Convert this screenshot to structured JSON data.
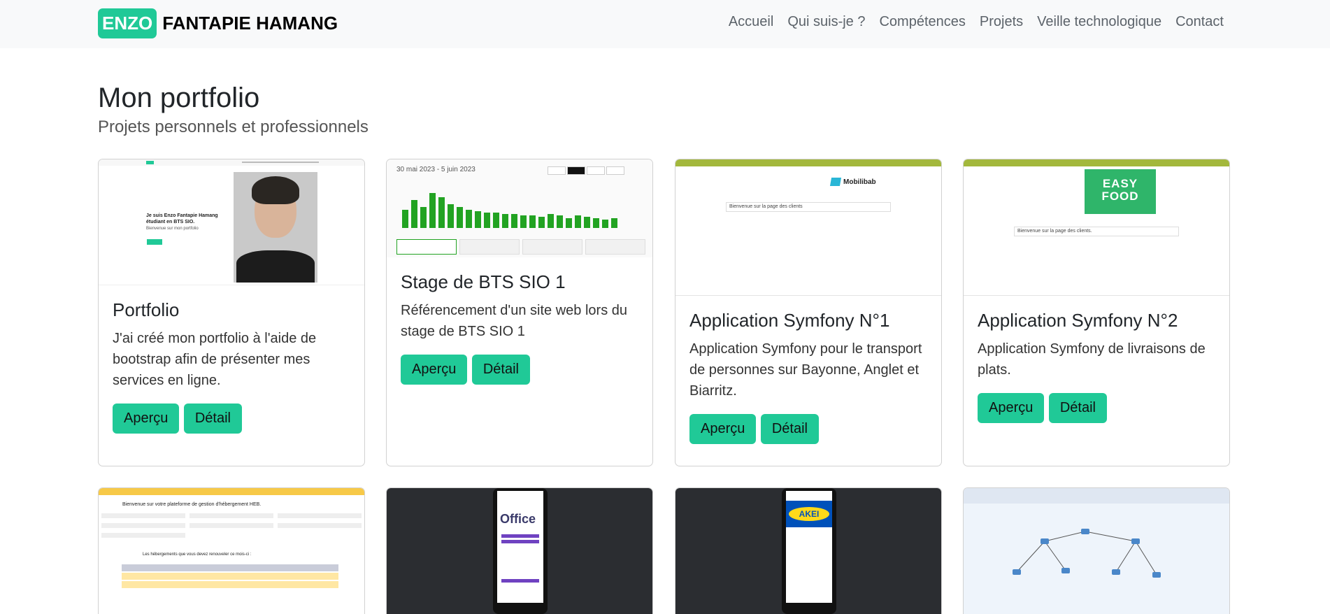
{
  "navbar": {
    "brand_badge": "ENZO",
    "brand_name": "FANTAPIE HAMANG",
    "links": [
      "Accueil",
      "Qui suis-je ?",
      "Compétences",
      "Projets",
      "Veille technologique",
      "Contact"
    ]
  },
  "header": {
    "title": "Mon portfolio",
    "subtitle": "Projets personnels et professionnels"
  },
  "thumbs": {
    "portfolio": {
      "headline": "Je suis Enzo Fantapie Hamang",
      "subline": "étudiant en BTS SIO.",
      "tagline": "Bienvenue sur mon portfolio"
    },
    "stage": {
      "date_range": "30 mai 2023 - 5 juin 2023"
    },
    "symfony1": {
      "logo": "Mobilibab",
      "welcome": "Bienvenue sur la page des clients"
    },
    "symfony2": {
      "logo_line1": "EASY",
      "logo_line2": "FOOD",
      "welcome": "Bienvenue sur la page des clients."
    },
    "heb": {
      "title": "Bienvenue sur votre plateforme de gestion d'hébergement HEB.",
      "sub": "Les hébergements que vous devez renouveler ce mois-ci :"
    },
    "office": {
      "logo": "Office"
    },
    "akei": {
      "logo": "AKEI"
    }
  },
  "buttons": {
    "apercu": "Aperçu",
    "detail": "Détail"
  },
  "cards": [
    {
      "title": "Portfolio",
      "text": "J'ai créé mon portfolio à l'aide de bootstrap afin de présenter mes services en ligne."
    },
    {
      "title": "Stage de BTS SIO 1",
      "text": "Référencement d'un site web lors du stage de BTS SIO 1"
    },
    {
      "title": "Application Symfony N°1",
      "text": "Application Symfony pour le transport de personnes sur Bayonne, Anglet et Biarritz."
    },
    {
      "title": "Application Symfony N°2",
      "text": "Application Symfony de livraisons de plats."
    }
  ],
  "colors": {
    "accent": "#20c997",
    "navbar_bg": "#f8f9fa",
    "chart_green": "#22a322",
    "olive": "#a3b83c"
  }
}
